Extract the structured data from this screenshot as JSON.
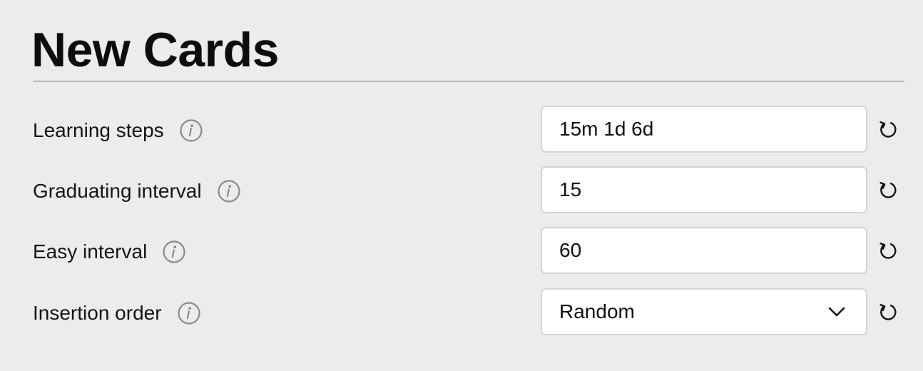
{
  "section": {
    "title": "New Cards"
  },
  "rows": [
    {
      "label": "Learning steps",
      "value": "15m 1d 6d",
      "kind": "text"
    },
    {
      "label": "Graduating interval",
      "value": "15",
      "kind": "number"
    },
    {
      "label": "Easy interval",
      "value": "60",
      "kind": "number"
    },
    {
      "label": "Insertion order",
      "value": "Random",
      "kind": "select"
    }
  ],
  "icons": {
    "info": "info-icon",
    "reset": "reset-icon",
    "dropdown": "chevron-down-icon"
  },
  "colors": {
    "background": "#ececec",
    "field_background": "#ffffff",
    "field_border": "#d4d4d4",
    "icon_gray": "#8a8a8a"
  }
}
